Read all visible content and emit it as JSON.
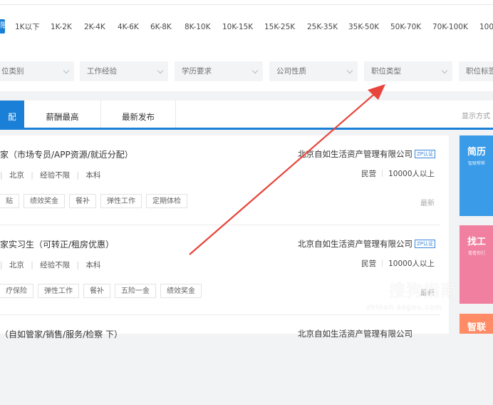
{
  "salary": {
    "active_label": "限",
    "options": [
      "1K以下",
      "1K-2K",
      "2K-4K",
      "4K-6K",
      "6K-8K",
      "8K-10K",
      "10K-15K",
      "15K-25K",
      "25K-35K",
      "35K-50K",
      "50K-70K",
      "70K-100K",
      "100"
    ]
  },
  "filters": [
    {
      "label": "位类别"
    },
    {
      "label": "工作经验"
    },
    {
      "label": "学历要求"
    },
    {
      "label": "公司性质"
    },
    {
      "label": "职位类型"
    },
    {
      "label": "职位标签"
    }
  ],
  "tabs": [
    "配",
    "薪酬最高",
    "最新发布"
  ],
  "display_mode": "显示方式",
  "jobs": [
    {
      "title": "家（市场专员/APP资源/就近分配）",
      "location": "北京",
      "experience": "经验不限",
      "education": "本科",
      "tags": [
        "贴",
        "绩效奖金",
        "餐补",
        "弹性工作",
        "定期体检"
      ],
      "company": "北京自如生活资产管理有限公司",
      "badge": "ZP认证",
      "company_type": "民营",
      "company_size": "10000人以上",
      "time": "最新"
    },
    {
      "title": "家实习生（可转正/租房优惠）",
      "location": "北京",
      "experience": "经验不限",
      "education": "本科",
      "tags": [
        "疗保险",
        "弹性工作",
        "餐补",
        "五险一金",
        "绩效奖金"
      ],
      "company": "北京自如生活资产管理有限公司",
      "badge": "ZP认证",
      "company_type": "民营",
      "company_size": "10000人以上",
      "time": "最新"
    },
    {
      "title": "（自如管家/销售/服务/检察 下）",
      "company": "北京自如生活资产管理有限公司"
    }
  ],
  "ads": [
    {
      "head": "简历",
      "sub": "智联帮帮",
      "color": "#3a9be8"
    },
    {
      "head": "找工",
      "sub": "看看你们",
      "color": "#f07fa0"
    },
    {
      "head": "智联",
      "color": "#ff8c66"
    }
  ],
  "watermark": {
    "logo": "S",
    "text": "搜狗指南",
    "url": "zhinan.sogou.com"
  },
  "annotation": {
    "color": "#e8453c"
  }
}
